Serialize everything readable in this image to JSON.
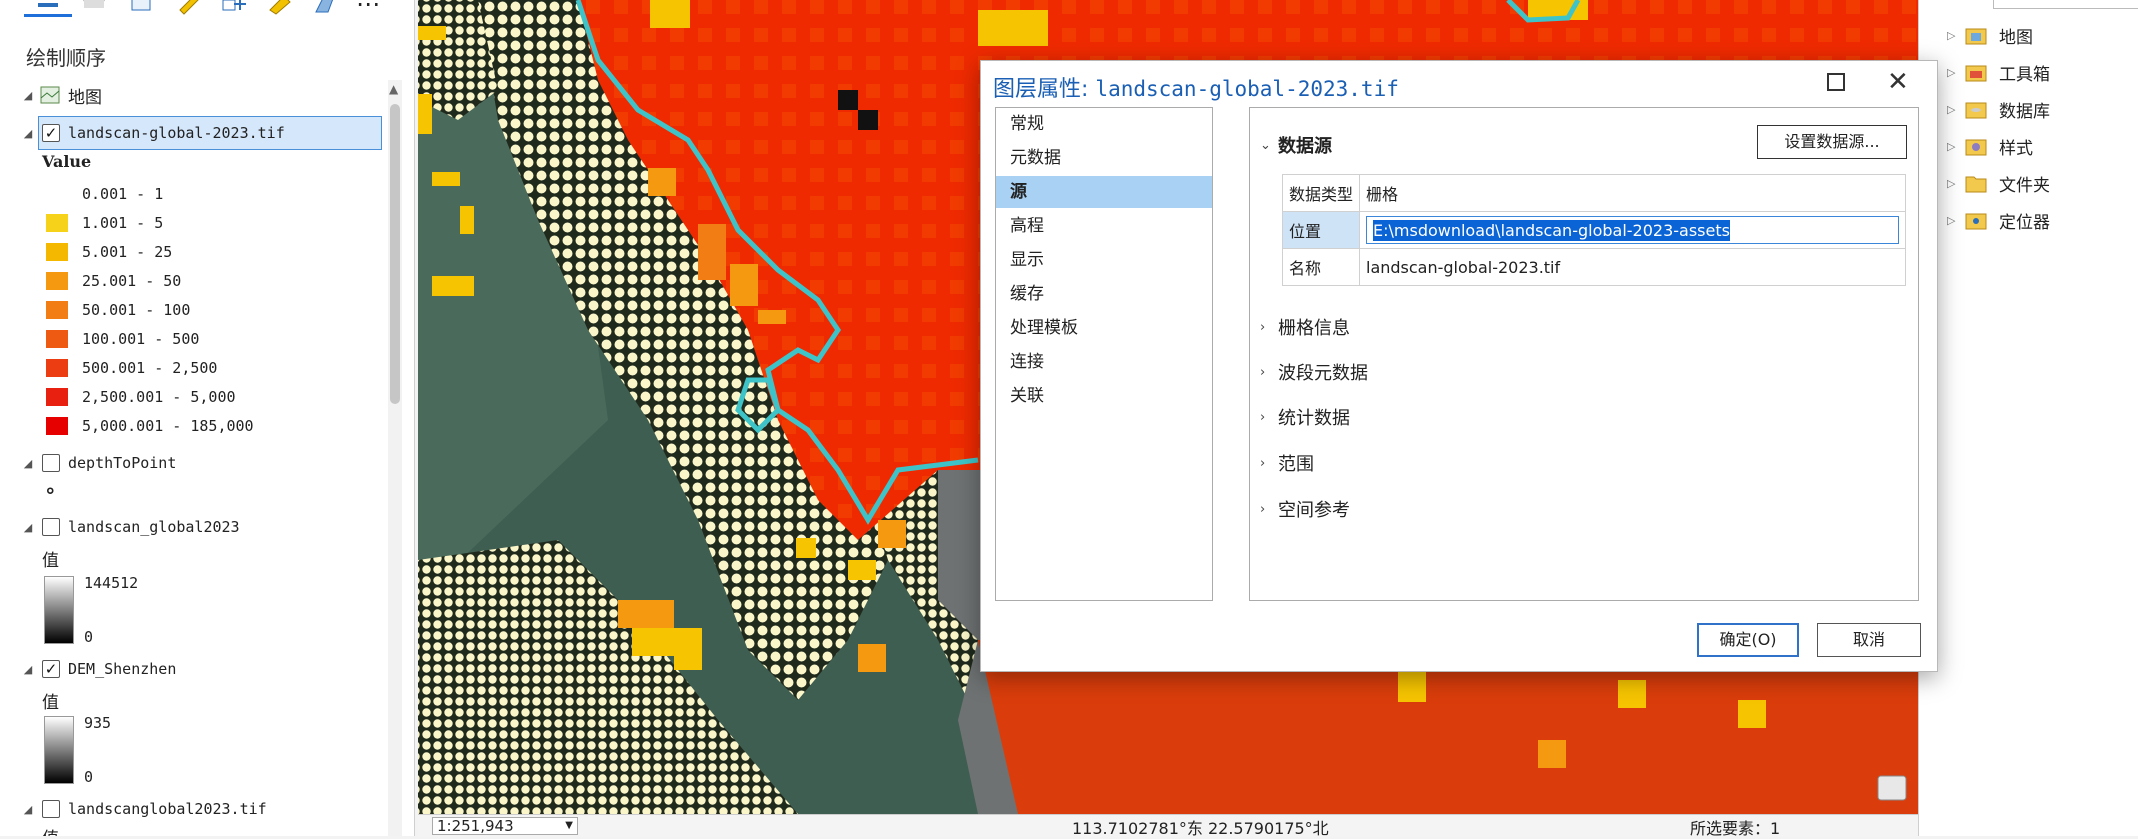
{
  "contents_pane": {
    "title": "绘制顺序",
    "map_label": "地图",
    "layers": [
      {
        "name": "landscan-global-2023.tif",
        "checked": true,
        "legend_heading": "Value",
        "classes": [
          {
            "label": "0.001 - 1",
            "color": "#ffffff"
          },
          {
            "label": "1.001 - 5",
            "color": "#f6d21a"
          },
          {
            "label": "5.001 - 25",
            "color": "#f5b800"
          },
          {
            "label": "25.001 - 50",
            "color": "#f59a10"
          },
          {
            "label": "50.001 - 100",
            "color": "#f27d14"
          },
          {
            "label": "100.001 - 500",
            "color": "#ef5a12"
          },
          {
            "label": "500.001 - 2,500",
            "color": "#ec3d12"
          },
          {
            "label": "2,500.001 - 5,000",
            "color": "#e82010"
          },
          {
            "label": "5,000.001 - 185,000",
            "color": "#e60000"
          }
        ]
      },
      {
        "name": "depthToPoint",
        "checked": false,
        "symbol": "∘"
      },
      {
        "name": "landscan_global2023",
        "checked": false,
        "legend_heading": "值",
        "high": "144512",
        "low": "0"
      },
      {
        "name": "DEM_Shenzhen",
        "checked": true,
        "legend_heading": "值",
        "high": "935",
        "low": "0"
      },
      {
        "name": "landscanglobal2023.tif",
        "checked": false,
        "legend_heading": "值"
      }
    ]
  },
  "status_bar": {
    "scale": "1:251,943",
    "coordinates": "113.7102781°东 22.5790175°北",
    "selected_features": "所选要素：1"
  },
  "catalog": {
    "items": [
      "地图",
      "工具箱",
      "数据库",
      "样式",
      "文件夹",
      "定位器"
    ]
  },
  "dialog": {
    "title_prefix": "图层属性:",
    "title_file": "landscan-global-2023.tif",
    "nav": [
      "常规",
      "元数据",
      "源",
      "高程",
      "显示",
      "缓存",
      "处理模板",
      "连接",
      "关联"
    ],
    "active_nav": "源",
    "section_source": "数据源",
    "set_source_button": "设置数据源...",
    "rows": [
      {
        "key": "数据类型",
        "value": "栅格"
      },
      {
        "key": "位置",
        "value": "E:\\msdownload\\landscan-global-2023-assets"
      },
      {
        "key": "名称",
        "value": "landscan-global-2023.tif"
      }
    ],
    "collapsed_sections": [
      "栅格信息",
      "波段元数据",
      "统计数据",
      "范围",
      "空间参考"
    ],
    "ok_button": "确定(O)",
    "cancel_button": "取消"
  }
}
